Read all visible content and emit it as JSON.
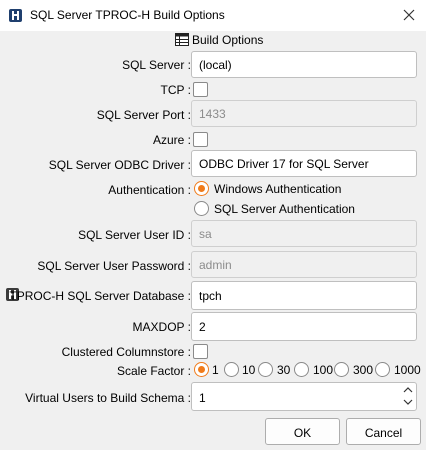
{
  "window": {
    "title": "SQL Server TPROC-H Build Options"
  },
  "section": {
    "title": "Build Options"
  },
  "fields": {
    "sql_server": {
      "label": "SQL Server :",
      "value": "(local)"
    },
    "tcp": {
      "label": "TCP :",
      "checked": false
    },
    "port": {
      "label": "SQL Server Port :",
      "value": "1433",
      "enabled": false
    },
    "azure": {
      "label": "Azure :",
      "checked": false
    },
    "odbc_driver": {
      "label": "SQL Server ODBC Driver :",
      "value": "ODBC Driver 17 for SQL Server"
    },
    "authentication": {
      "label": "Authentication :",
      "options": [
        "Windows Authentication",
        "SQL Server Authentication"
      ],
      "selected": "Windows Authentication"
    },
    "user_id": {
      "label": "SQL Server User ID :",
      "value": "sa",
      "enabled": false
    },
    "user_password": {
      "label": "SQL Server User Password :",
      "value": "admin",
      "enabled": false
    },
    "database": {
      "label": "TPROC-H SQL Server Database :",
      "value": "tpch"
    },
    "maxdop": {
      "label": "MAXDOP :",
      "value": "2"
    },
    "clustered_columnstore": {
      "label": "Clustered Columnstore :",
      "checked": false
    },
    "scale_factor": {
      "label": "Scale Factor :",
      "options": [
        "1",
        "10",
        "30",
        "100",
        "300",
        "1000"
      ],
      "selected": "1"
    },
    "virtual_users": {
      "label": "Virtual Users to Build Schema :",
      "value": "1"
    }
  },
  "buttons": {
    "ok": "OK",
    "cancel": "Cancel"
  },
  "icons": {
    "app": "hammerdb-app-icon",
    "close": "close-icon",
    "section": "table-icon",
    "database": "hammerdb-icon",
    "spin": "spinbox-arrows-icon"
  },
  "colors": {
    "accent": "#f07b1a",
    "app_icon": "#1f3f6e"
  }
}
